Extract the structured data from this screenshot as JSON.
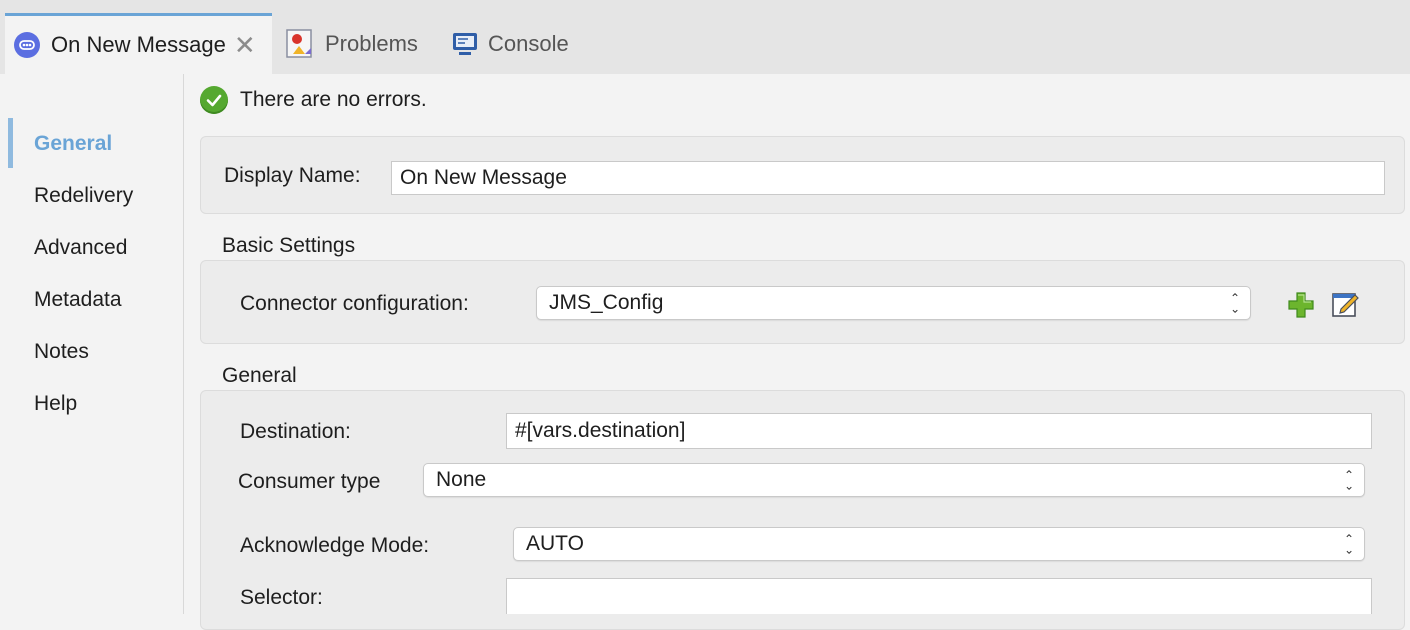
{
  "tabs": [
    {
      "label": "On New Message",
      "icon": "message-source-icon",
      "active": true
    },
    {
      "label": "Problems",
      "icon": "problems-icon",
      "active": false
    },
    {
      "label": "Console",
      "icon": "console-icon",
      "active": false
    }
  ],
  "sidebar": {
    "items": [
      {
        "label": "General",
        "selected": true
      },
      {
        "label": "Redelivery"
      },
      {
        "label": "Advanced"
      },
      {
        "label": "Metadata"
      },
      {
        "label": "Notes"
      },
      {
        "label": "Help"
      }
    ]
  },
  "status": {
    "message": "There are no errors.",
    "icon": "check-circle-icon"
  },
  "display_name": {
    "label": "Display Name:",
    "value": "On New Message"
  },
  "basic_settings": {
    "title": "Basic Settings",
    "connector_label": "Connector configuration:",
    "connector_value": "JMS_Config"
  },
  "general": {
    "title": "General",
    "destination_label": "Destination:",
    "destination_value": "#[vars.destination]",
    "consumer_type_label": "Consumer type",
    "consumer_type_value": "None",
    "ack_mode_label": "Acknowledge Mode:",
    "ack_mode_value": "AUTO",
    "selector_label": "Selector:",
    "selector_value": ""
  },
  "colors": {
    "accent": "#6aa4d6",
    "success": "#55a830",
    "add": "#6cb52d"
  }
}
